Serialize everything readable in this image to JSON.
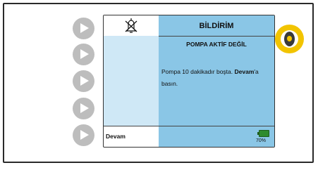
{
  "screen": {
    "title": "BİLDİRİM",
    "subtitle": "POMPA AKTİF DEĞİL",
    "message_part1": "Pompa 10 dakikadır boşta.",
    "message_bold": "Devam",
    "message_part2": "'a basın.",
    "left_button_label": "Devam",
    "battery_percent_text": "70%"
  },
  "icons": {
    "alarm_silenced": "bell-crossed-icon",
    "side_buttons": "play-arrow-icon",
    "battery": "battery-icon",
    "highlighted_control": "rotary-knob-icon"
  },
  "colors": {
    "screen_blue": "#8ac6e6",
    "left_blue": "#cfe8f6",
    "side_button_gray": "#bdbdbd",
    "highlight_yellow": "#f2c400",
    "battery_green": "#2e8b2e"
  }
}
